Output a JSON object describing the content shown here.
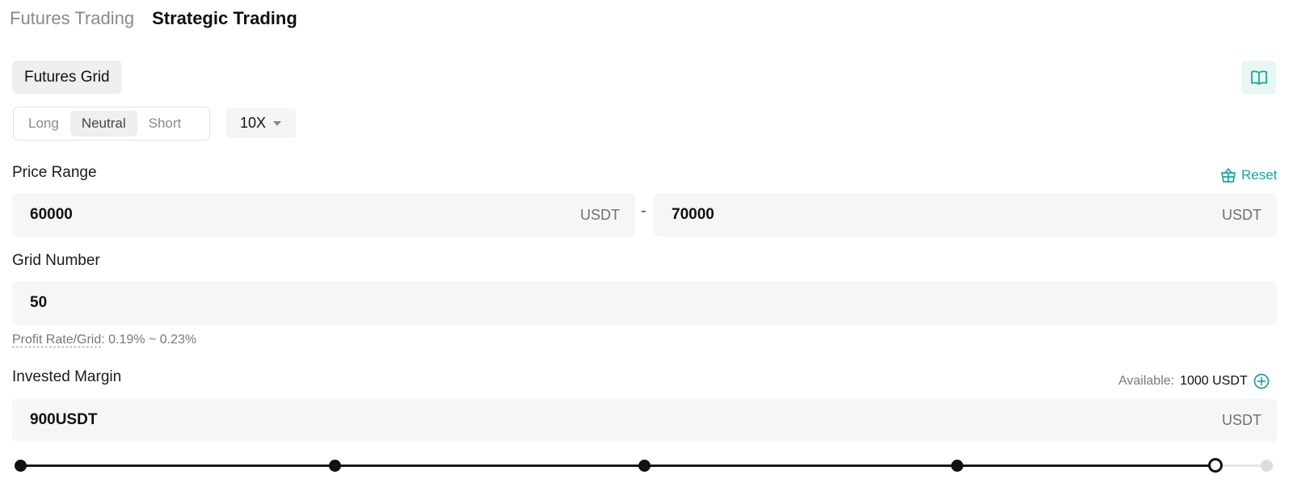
{
  "tabs": {
    "futures": "Futures Trading",
    "strategic": "Strategic Trading"
  },
  "mode": {
    "label": "Futures Grid"
  },
  "direction": {
    "options": [
      "Long",
      "Neutral",
      "Short"
    ],
    "selected": "Neutral"
  },
  "leverage": {
    "value": "10X"
  },
  "price_range": {
    "label": "Price Range",
    "reset_label": "Reset",
    "lower_value": "60000",
    "upper_value": "70000",
    "unit": "USDT",
    "separator": "-"
  },
  "grid": {
    "label": "Grid Number",
    "value": "50",
    "profit_label": "Profit Rate/Grid",
    "profit_value": ": 0.19% ~ 0.23%"
  },
  "margin": {
    "label": "Invested Margin",
    "available_label": "Available:",
    "available_value": "1000 USDT",
    "value": "900USDT",
    "unit": "USDT",
    "slider_fraction": 0.9
  },
  "colors": {
    "accent": "#16a89a",
    "field_bg": "#f5f6f7"
  },
  "icons": {
    "guide": "book-icon",
    "reset": "basket-icon",
    "add": "plus-circle-icon"
  }
}
